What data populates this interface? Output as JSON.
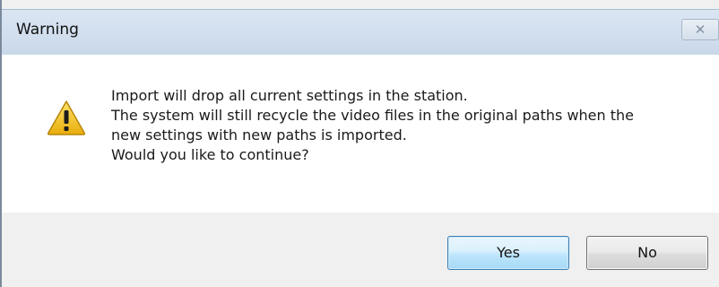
{
  "dialog": {
    "title": "Warning",
    "close_icon": "close-icon",
    "icon": "warning-icon",
    "message_lines": [
      "Import will drop all current settings in the station.",
      "The system will still recycle the video files in the original paths when the",
      "new settings with new paths is imported.",
      "Would you like to continue?"
    ],
    "buttons": {
      "yes_label": "Yes",
      "no_label": "No"
    }
  },
  "colors": {
    "titlebar": "#c9d8ea",
    "warning_yellow": "#f2c414",
    "default_button_border": "#3c7fb1"
  }
}
